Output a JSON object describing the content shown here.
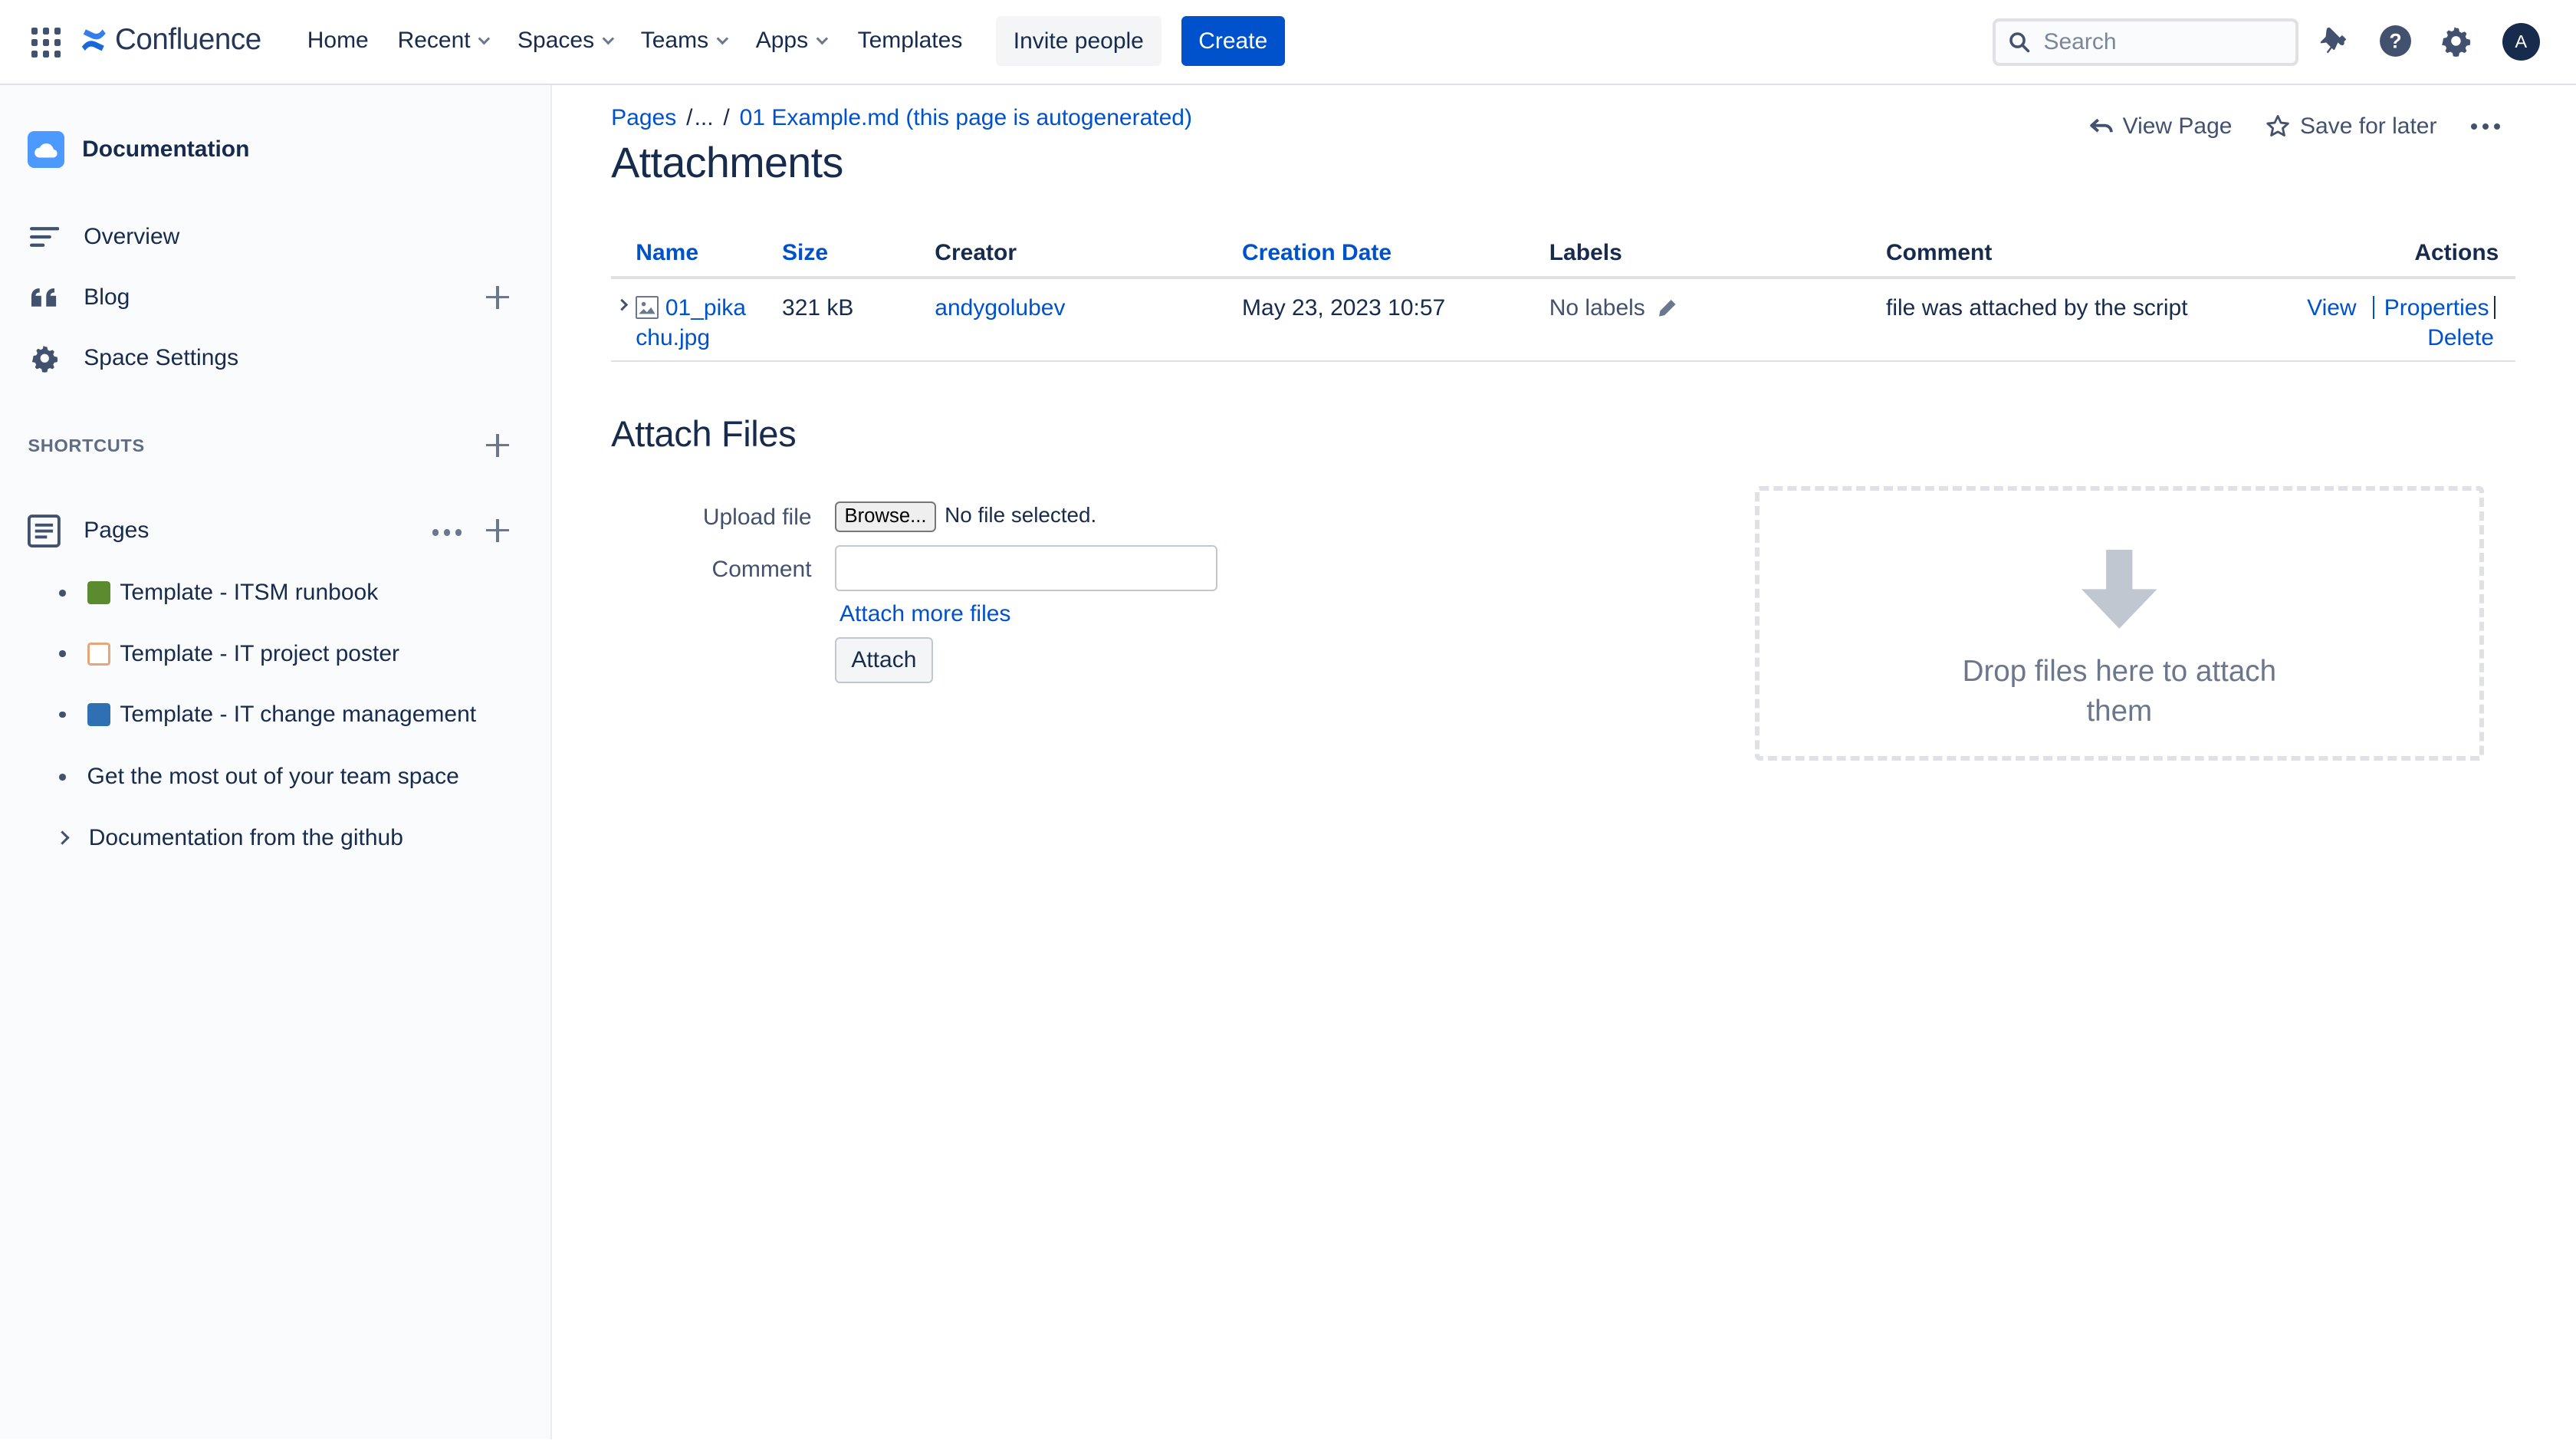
{
  "topnav": {
    "logo_text": "Confluence",
    "items": [
      {
        "label": "Home",
        "dropdown": false
      },
      {
        "label": "Recent",
        "dropdown": true
      },
      {
        "label": "Spaces",
        "dropdown": true
      },
      {
        "label": "Teams",
        "dropdown": true
      },
      {
        "label": "Apps",
        "dropdown": true
      },
      {
        "label": "Templates",
        "dropdown": false
      }
    ],
    "invite_label": "Invite people",
    "create_label": "Create",
    "search_placeholder": "Search",
    "avatar_initial": "A",
    "icons": [
      "app-switcher-icon",
      "notifications-icon",
      "help-icon",
      "settings-icon"
    ]
  },
  "sidebar": {
    "space_name": "Documentation",
    "items": [
      {
        "label": "Overview",
        "icon": "overview-icon"
      },
      {
        "label": "Blog",
        "icon": "blog-quote-icon"
      },
      {
        "label": "Space Settings",
        "icon": "gear-icon"
      }
    ],
    "shortcuts_label": "SHORTCUTS",
    "pages_label": "Pages",
    "pages": [
      {
        "label": "Template - ITSM runbook",
        "marker": "bullet",
        "emoji_color": "#5b8a2f"
      },
      {
        "label": "Template - IT project poster",
        "marker": "bullet",
        "emoji_color": "#e6a67a"
      },
      {
        "label": "Template - IT change management",
        "marker": "bullet",
        "emoji_color": "#2f6fb3"
      },
      {
        "label": "Get the most out of your team space",
        "marker": "bullet",
        "emoji_color": ""
      },
      {
        "label": "Documentation from the github",
        "marker": "chevron",
        "emoji_color": ""
      }
    ]
  },
  "breadcrumb": {
    "root": "Pages",
    "sep1": "/",
    "ellipsis": "...",
    "sep2": "/",
    "current": "01 Example.md (this page is autogenerated)"
  },
  "page_actions": {
    "view_page": "View Page",
    "save_for_later": "Save for later"
  },
  "page_title": "Attachments",
  "table": {
    "headers": {
      "name": "Name",
      "size": "Size",
      "creator": "Creator",
      "creation_date": "Creation Date",
      "labels": "Labels",
      "comment": "Comment",
      "actions": "Actions"
    },
    "rows": [
      {
        "name_line1": "01_pika",
        "name_line2": "chu.jpg",
        "size": "321 kB",
        "creator": "andygolubev",
        "creation_date": "May 23, 2023 10:57",
        "labels": "No labels",
        "comment": "file was attached by the script",
        "action_view": "View",
        "action_properties": "Properties",
        "action_delete": "Delete"
      }
    ]
  },
  "attach": {
    "heading": "Attach Files",
    "upload_label": "Upload file",
    "browse_label": "Browse...",
    "no_file": "No file selected.",
    "comment_label": "Comment",
    "comment_value": "",
    "more_files": "Attach more files",
    "attach_button": "Attach",
    "drop_text": "Drop files here to attach them"
  },
  "colors": {
    "brand": "#0052cc",
    "text": "#172b4d",
    "muted": "#6b778c",
    "sidebar_bg": "#fafbfc"
  }
}
